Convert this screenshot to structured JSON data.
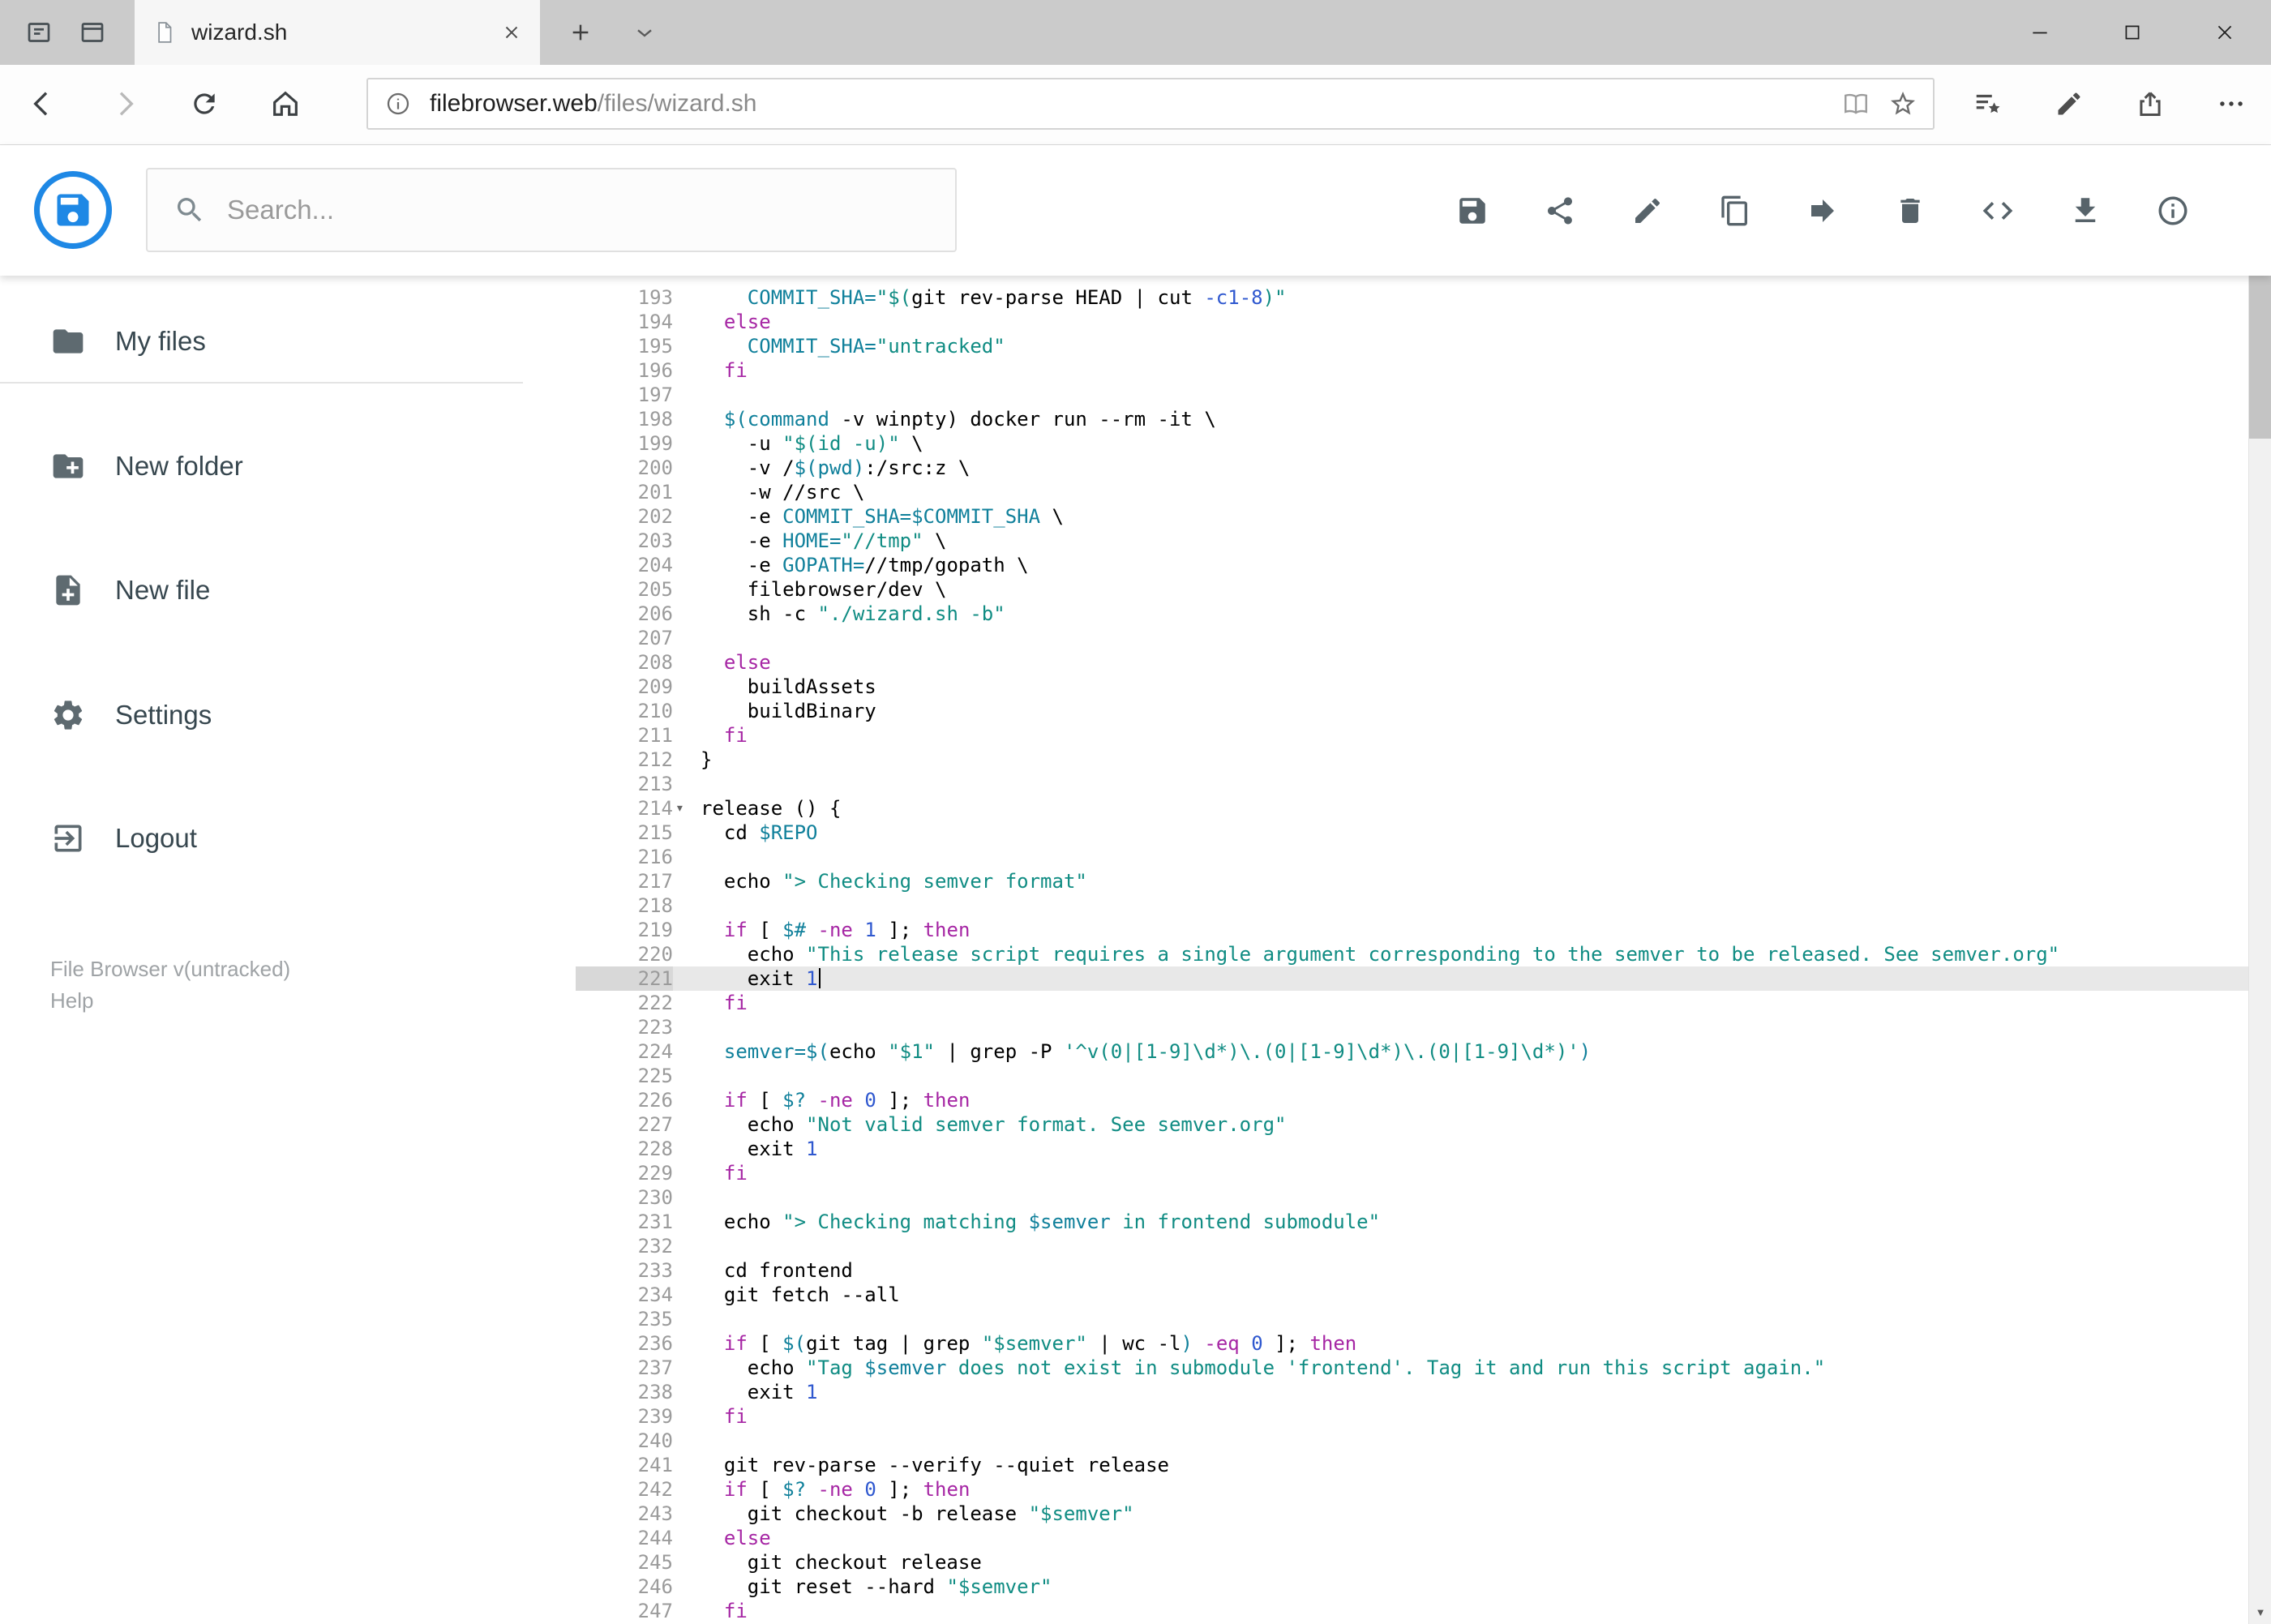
{
  "colors": {
    "accent_blue": "#1E88E5",
    "active_line_bg": "#E8E8E8",
    "tabstrip_bg": "#CBCBCB",
    "syntax": {
      "kw": "#A626A4",
      "str": "#108C83",
      "var": "#10809B",
      "num": "#2F58CF",
      "plain": "#000000"
    }
  },
  "browser": {
    "tab_title": "wizard.sh",
    "url_host": "filebrowser.web",
    "url_path": "/files/wizard.sh",
    "icons": [
      "tabs-aside",
      "tab-list",
      "tab-close",
      "new-tab",
      "tab-preview-chevron",
      "minimize",
      "maximize",
      "close",
      "back",
      "forward",
      "refresh",
      "home",
      "page-info",
      "reading-view",
      "favorite-star",
      "hub",
      "web-note-pen",
      "share",
      "more-options"
    ]
  },
  "app_header": {
    "search_placeholder": "Search...",
    "action_icons": [
      "save",
      "share",
      "rename",
      "copy",
      "move",
      "delete",
      "raw-view",
      "download",
      "info"
    ]
  },
  "sidebar": {
    "items": [
      {
        "label": "My files",
        "icon": "folder"
      },
      {
        "label": "New folder",
        "icon": "new-folder"
      },
      {
        "label": "New file",
        "icon": "new-file"
      },
      {
        "label": "Settings",
        "icon": "settings-gear"
      },
      {
        "label": "Logout",
        "icon": "logout"
      }
    ],
    "footer_version": "File Browser v(untracked)",
    "footer_help": "Help"
  },
  "editor": {
    "language": "shell",
    "active_line": 221,
    "fold_line": 214,
    "lines": [
      {
        "n": 193,
        "t": [
          [
            "p",
            "    "
          ],
          [
            "v",
            "COMMIT_SHA="
          ],
          [
            "s",
            "\"$("
          ],
          [
            "p",
            "git rev-parse HEAD | cut "
          ],
          [
            "n",
            "-c1-8"
          ],
          [
            "s",
            ")\""
          ]
        ]
      },
      {
        "n": 194,
        "t": [
          [
            "p",
            "  "
          ],
          [
            "k",
            "else"
          ]
        ]
      },
      {
        "n": 195,
        "t": [
          [
            "p",
            "    "
          ],
          [
            "v",
            "COMMIT_SHA="
          ],
          [
            "s",
            "\"untracked\""
          ]
        ]
      },
      {
        "n": 196,
        "t": [
          [
            "p",
            "  "
          ],
          [
            "k",
            "fi"
          ]
        ]
      },
      {
        "n": 197,
        "t": []
      },
      {
        "n": 198,
        "t": [
          [
            "p",
            "  "
          ],
          [
            "v",
            "$(command"
          ],
          [
            "p",
            " -v winpty) docker run --rm -it \\"
          ]
        ]
      },
      {
        "n": 199,
        "t": [
          [
            "p",
            "    -u "
          ],
          [
            "s",
            "\"$(id -u)\""
          ],
          [
            "p",
            " \\"
          ]
        ]
      },
      {
        "n": 200,
        "t": [
          [
            "p",
            "    -v /"
          ],
          [
            "v",
            "$(pwd)"
          ],
          [
            "p",
            ":/src:z \\"
          ]
        ]
      },
      {
        "n": 201,
        "t": [
          [
            "p",
            "    -w //src \\"
          ]
        ]
      },
      {
        "n": 202,
        "t": [
          [
            "p",
            "    -e "
          ],
          [
            "v",
            "COMMIT_SHA=$COMMIT_SHA"
          ],
          [
            "p",
            " \\"
          ]
        ]
      },
      {
        "n": 203,
        "t": [
          [
            "p",
            "    -e "
          ],
          [
            "v",
            "HOME="
          ],
          [
            "s",
            "\"//tmp\""
          ],
          [
            "p",
            " \\"
          ]
        ]
      },
      {
        "n": 204,
        "t": [
          [
            "p",
            "    -e "
          ],
          [
            "v",
            "GOPATH="
          ],
          [
            "p",
            "//tmp/gopath \\"
          ]
        ]
      },
      {
        "n": 205,
        "t": [
          [
            "p",
            "    filebrowser/dev \\"
          ]
        ]
      },
      {
        "n": 206,
        "t": [
          [
            "p",
            "    sh -c "
          ],
          [
            "s",
            "\"./wizard.sh -b\""
          ]
        ]
      },
      {
        "n": 207,
        "t": []
      },
      {
        "n": 208,
        "t": [
          [
            "p",
            "  "
          ],
          [
            "k",
            "else"
          ]
        ]
      },
      {
        "n": 209,
        "t": [
          [
            "p",
            "    buildAssets"
          ]
        ]
      },
      {
        "n": 210,
        "t": [
          [
            "p",
            "    buildBinary"
          ]
        ]
      },
      {
        "n": 211,
        "t": [
          [
            "p",
            "  "
          ],
          [
            "k",
            "fi"
          ]
        ]
      },
      {
        "n": 212,
        "t": [
          [
            "p",
            "}"
          ]
        ]
      },
      {
        "n": 213,
        "t": []
      },
      {
        "n": 214,
        "fold": true,
        "t": [
          [
            "p",
            "release () {"
          ]
        ]
      },
      {
        "n": 215,
        "t": [
          [
            "p",
            "  cd "
          ],
          [
            "v",
            "$REPO"
          ]
        ]
      },
      {
        "n": 216,
        "t": []
      },
      {
        "n": 217,
        "t": [
          [
            "p",
            "  echo "
          ],
          [
            "s",
            "\"> Checking semver format\""
          ]
        ]
      },
      {
        "n": 218,
        "t": []
      },
      {
        "n": 219,
        "t": [
          [
            "p",
            "  "
          ],
          [
            "k",
            "if"
          ],
          [
            "p",
            " [ "
          ],
          [
            "v",
            "$#"
          ],
          [
            "p",
            " "
          ],
          [
            "k",
            "-ne"
          ],
          [
            "p",
            " "
          ],
          [
            "n",
            "1"
          ],
          [
            "p",
            " ]; "
          ],
          [
            "k",
            "then"
          ]
        ]
      },
      {
        "n": 220,
        "t": [
          [
            "p",
            "    echo "
          ],
          [
            "s",
            "\"This release script requires a single argument corresponding to the semver to be released. See semver.org\""
          ]
        ]
      },
      {
        "n": 221,
        "t": [
          [
            "p",
            "    exit "
          ],
          [
            "n",
            "1"
          ]
        ]
      },
      {
        "n": 222,
        "t": [
          [
            "p",
            "  "
          ],
          [
            "k",
            "fi"
          ]
        ]
      },
      {
        "n": 223,
        "t": []
      },
      {
        "n": 224,
        "t": [
          [
            "p",
            "  "
          ],
          [
            "v",
            "semver=$("
          ],
          [
            "p",
            "echo "
          ],
          [
            "s",
            "\"$1\""
          ],
          [
            "p",
            " | grep -P "
          ],
          [
            "s",
            "'^v(0|[1-9]\\d*)\\.(0|[1-9]\\d*)\\.(0|[1-9]\\d*)'"
          ],
          [
            "v",
            ")"
          ]
        ]
      },
      {
        "n": 225,
        "t": []
      },
      {
        "n": 226,
        "t": [
          [
            "p",
            "  "
          ],
          [
            "k",
            "if"
          ],
          [
            "p",
            " [ "
          ],
          [
            "v",
            "$?"
          ],
          [
            "p",
            " "
          ],
          [
            "k",
            "-ne"
          ],
          [
            "p",
            " "
          ],
          [
            "n",
            "0"
          ],
          [
            "p",
            " ]; "
          ],
          [
            "k",
            "then"
          ]
        ]
      },
      {
        "n": 227,
        "t": [
          [
            "p",
            "    echo "
          ],
          [
            "s",
            "\"Not valid semver format. See semver.org\""
          ]
        ]
      },
      {
        "n": 228,
        "t": [
          [
            "p",
            "    exit "
          ],
          [
            "n",
            "1"
          ]
        ]
      },
      {
        "n": 229,
        "t": [
          [
            "p",
            "  "
          ],
          [
            "k",
            "fi"
          ]
        ]
      },
      {
        "n": 230,
        "t": []
      },
      {
        "n": 231,
        "t": [
          [
            "p",
            "  echo "
          ],
          [
            "s",
            "\"> Checking matching "
          ],
          [
            "v",
            "$semver"
          ],
          [
            "s",
            " in frontend submodule\""
          ]
        ]
      },
      {
        "n": 232,
        "t": []
      },
      {
        "n": 233,
        "t": [
          [
            "p",
            "  cd frontend"
          ]
        ]
      },
      {
        "n": 234,
        "t": [
          [
            "p",
            "  git fetch --all"
          ]
        ]
      },
      {
        "n": 235,
        "t": []
      },
      {
        "n": 236,
        "t": [
          [
            "p",
            "  "
          ],
          [
            "k",
            "if"
          ],
          [
            "p",
            " [ "
          ],
          [
            "v",
            "$("
          ],
          [
            "p",
            "git tag | grep "
          ],
          [
            "s",
            "\"$semver\""
          ],
          [
            "p",
            " | wc -l"
          ],
          [
            "v",
            ")"
          ],
          [
            "p",
            " "
          ],
          [
            "k",
            "-eq"
          ],
          [
            "p",
            " "
          ],
          [
            "n",
            "0"
          ],
          [
            "p",
            " ]; "
          ],
          [
            "k",
            "then"
          ]
        ]
      },
      {
        "n": 237,
        "t": [
          [
            "p",
            "    echo "
          ],
          [
            "s",
            "\"Tag "
          ],
          [
            "v",
            "$semver"
          ],
          [
            "s",
            " does not exist in submodule 'frontend'. Tag it and run this script again.\""
          ]
        ]
      },
      {
        "n": 238,
        "t": [
          [
            "p",
            "    exit "
          ],
          [
            "n",
            "1"
          ]
        ]
      },
      {
        "n": 239,
        "t": [
          [
            "p",
            "  "
          ],
          [
            "k",
            "fi"
          ]
        ]
      },
      {
        "n": 240,
        "t": []
      },
      {
        "n": 241,
        "t": [
          [
            "p",
            "  git rev-parse --verify --quiet release"
          ]
        ]
      },
      {
        "n": 242,
        "t": [
          [
            "p",
            "  "
          ],
          [
            "k",
            "if"
          ],
          [
            "p",
            " [ "
          ],
          [
            "v",
            "$?"
          ],
          [
            "p",
            " "
          ],
          [
            "k",
            "-ne"
          ],
          [
            "p",
            " "
          ],
          [
            "n",
            "0"
          ],
          [
            "p",
            " ]; "
          ],
          [
            "k",
            "then"
          ]
        ]
      },
      {
        "n": 243,
        "t": [
          [
            "p",
            "    git checkout -b release "
          ],
          [
            "s",
            "\"$semver\""
          ]
        ]
      },
      {
        "n": 244,
        "t": [
          [
            "p",
            "  "
          ],
          [
            "k",
            "else"
          ]
        ]
      },
      {
        "n": 245,
        "t": [
          [
            "p",
            "    git checkout release"
          ]
        ]
      },
      {
        "n": 246,
        "t": [
          [
            "p",
            "    git reset --hard "
          ],
          [
            "s",
            "\"$semver\""
          ]
        ]
      },
      {
        "n": 247,
        "t": [
          [
            "p",
            "  "
          ],
          [
            "k",
            "fi"
          ]
        ]
      }
    ]
  }
}
